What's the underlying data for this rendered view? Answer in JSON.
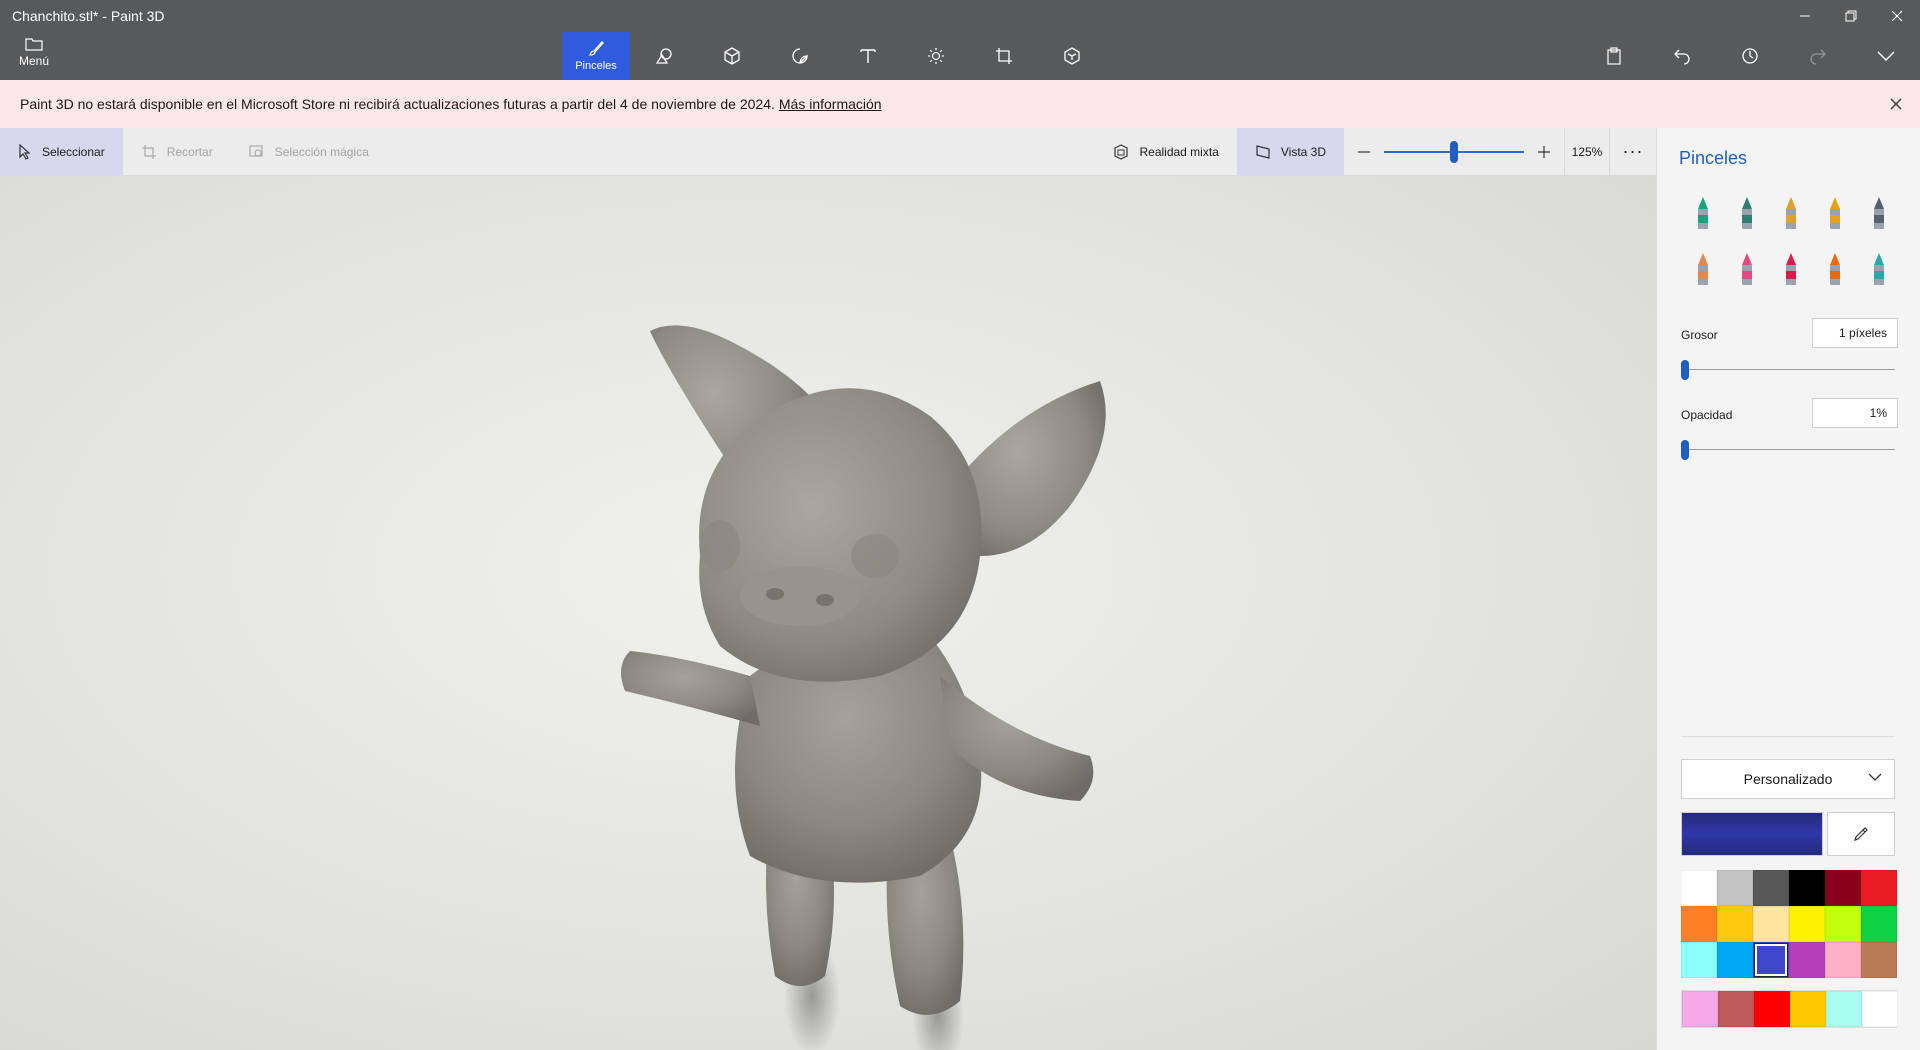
{
  "window": {
    "title": "Chanchito.stl* - Paint 3D",
    "controls": [
      "minimize",
      "restore",
      "close"
    ]
  },
  "menu": {
    "label": "Menú"
  },
  "ribbon": {
    "tools": [
      {
        "id": "brushes",
        "label": "Pinceles",
        "icon": "brush-icon",
        "active": true
      },
      {
        "id": "2d-shapes",
        "label": "",
        "icon": "2d-shapes-icon"
      },
      {
        "id": "3d-shapes",
        "label": "",
        "icon": "3d-shapes-icon"
      },
      {
        "id": "stickers",
        "label": "",
        "icon": "stickers-icon"
      },
      {
        "id": "text",
        "label": "",
        "icon": "text-icon"
      },
      {
        "id": "effects",
        "label": "",
        "icon": "effects-icon"
      },
      {
        "id": "canvas",
        "label": "",
        "icon": "canvas-icon"
      },
      {
        "id": "3d-library",
        "label": "",
        "icon": "3d-library-icon"
      }
    ],
    "right": [
      "paste-icon",
      "undo-icon",
      "history-icon",
      "redo-icon",
      "expand-icon"
    ]
  },
  "notice": {
    "text": "Paint 3D no estará disponible en el Microsoft Store ni recibirá actualizaciones futuras a partir del 4 de noviembre de 2024.",
    "link": "Más información"
  },
  "subtoolbar": {
    "select": "Seleccionar",
    "crop": "Recortar",
    "magic_select": "Selección mágica",
    "mixed_reality": "Realidad mixta",
    "view_3d": "Vista 3D",
    "zoom": "125%",
    "zoom_level": 0.5
  },
  "panel": {
    "title": "Pinceles",
    "brushes": [
      {
        "name": "marker",
        "color": "#1aa37a"
      },
      {
        "name": "calligraphy-pen",
        "color": "#2e7d74"
      },
      {
        "name": "oil-brush",
        "color": "#e0a030"
      },
      {
        "name": "watercolor",
        "color": "#e8a020"
      },
      {
        "name": "pixel-pen",
        "color": "#556070"
      },
      {
        "name": "pencil",
        "color": "#e08a50"
      },
      {
        "name": "eraser",
        "color": "#e04a80"
      },
      {
        "name": "crayon",
        "color": "#d81b4a"
      },
      {
        "name": "spray-can",
        "color": "#e86a10"
      },
      {
        "name": "fill",
        "color": "#2aa8a8"
      }
    ],
    "thickness": {
      "label": "Grosor",
      "value": "1 píxeles",
      "level": 0
    },
    "opacity": {
      "label": "Opacidad",
      "value": "1%",
      "level": 0
    },
    "color_mode": "Personalizado",
    "current_color": "#232a7a",
    "palette": [
      "#ffffff",
      "#c3c3c3",
      "#585858",
      "#000000",
      "#88001b",
      "#ec1c24",
      "#ff7f27",
      "#ffc90e",
      "#ffe5a0",
      "#fff200",
      "#c4ff0e",
      "#0ed145",
      "#8cfffb",
      "#00a8f3",
      "#3f48cc",
      "#b83dba",
      "#ffaec8",
      "#b97a56"
    ],
    "selected_swatch": 14,
    "custom_palette": [
      "#f7a8e8",
      "#c05a5a",
      "#ff0000",
      "#ffc800",
      "#a8fff0",
      "#ffffff"
    ]
  }
}
